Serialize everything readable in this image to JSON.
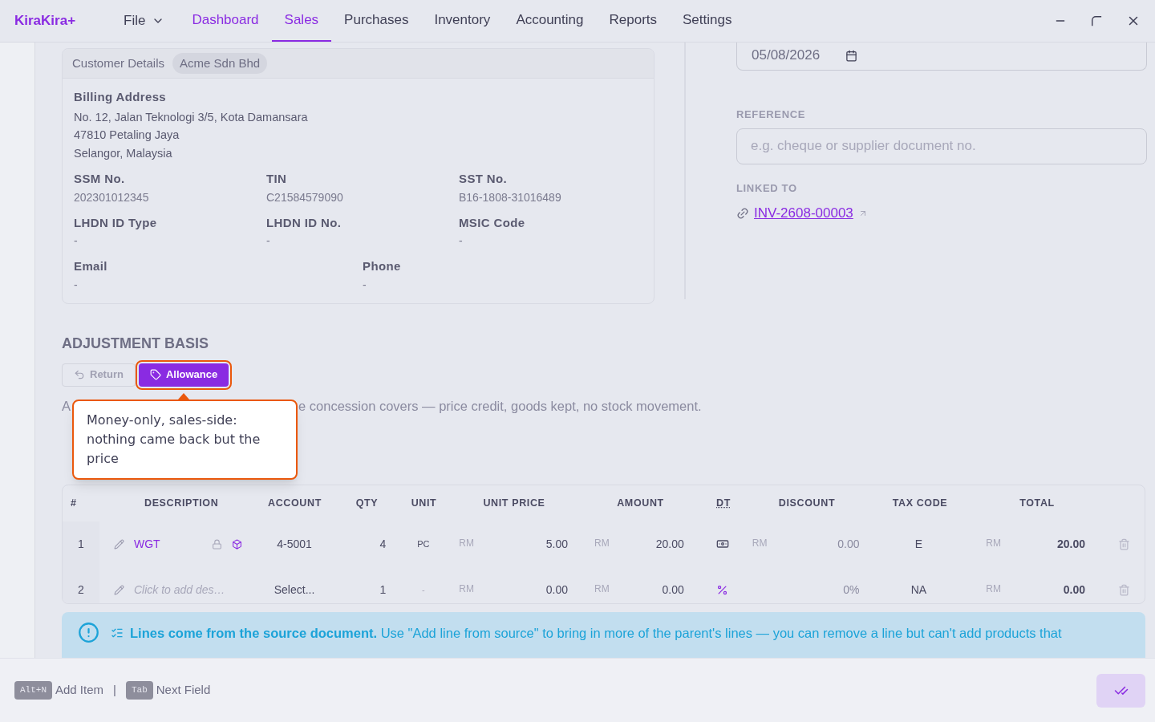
{
  "app": {
    "logo": "KiraKira+"
  },
  "menu": {
    "label": "File"
  },
  "nav": [
    {
      "label": "Dashboard",
      "selected": false,
      "highlighted": true
    },
    {
      "label": "Sales",
      "selected": true,
      "highlighted": true
    },
    {
      "label": "Purchases",
      "selected": false,
      "highlighted": false
    },
    {
      "label": "Inventory",
      "selected": false,
      "highlighted": false
    },
    {
      "label": "Accounting",
      "selected": false,
      "highlighted": false
    },
    {
      "label": "Reports",
      "selected": false,
      "highlighted": false
    },
    {
      "label": "Settings",
      "selected": false,
      "highlighted": false
    }
  ],
  "customer": {
    "title": "Customer Details",
    "name": "Acme Sdn Bhd",
    "billing_label": "Billing Address",
    "address": [
      "No. 12, Jalan Teknologi 3/5, Kota Damansara",
      "47810 Petaling Jaya",
      "Selangor, Malaysia"
    ],
    "fields": [
      {
        "label": "SSM No.",
        "value": "202301012345"
      },
      {
        "label": "TIN",
        "value": "C21584579090"
      },
      {
        "label": "SST No.",
        "value": "B16-1808-31016489"
      },
      {
        "label": "LHDN ID Type",
        "value": "-"
      },
      {
        "label": "LHDN ID No.",
        "value": "-"
      },
      {
        "label": "MSIC Code",
        "value": "-"
      }
    ],
    "contact": [
      {
        "label": "Email",
        "value": "-"
      },
      {
        "label": "Phone",
        "value": "-"
      }
    ]
  },
  "date_field": {
    "value": "05/08/2026"
  },
  "reference": {
    "label": "REFERENCE",
    "placeholder": "e.g. cheque or supplier document no."
  },
  "linked": {
    "label": "LINKED TO",
    "link": "INV-2608-00003"
  },
  "adjustment": {
    "title": "ADJUSTMENT BASIS",
    "options": [
      {
        "label": "Return",
        "kind": "return",
        "selected": false
      },
      {
        "label": "Allowance",
        "kind": "allowance",
        "selected": true
      }
    ],
    "description_start": "A",
    "description_end": "e concession covers — price credit, goods kept, no stock movement.",
    "tooltip": "Money-only, sales-side: nothing came back but the price"
  },
  "table": {
    "columns": [
      "#",
      "DESCRIPTION",
      "ACCOUNT",
      "QTY",
      "UNIT",
      "UNIT PRICE",
      "AMOUNT",
      "DT",
      "DISCOUNT",
      "TAX CODE",
      "TOTAL"
    ],
    "rows": [
      {
        "no": "1",
        "description": "WGT",
        "kind": "item",
        "account": "4-5001",
        "qty": "4",
        "unit": "PC",
        "price_currency": "RM",
        "unit_price": "5.00",
        "amount_currency": "RM",
        "amount": "20.00",
        "dt_percent": false,
        "discount_currency": "RM",
        "discount": "0.00",
        "tax_code": "E",
        "total_currency": "RM",
        "total": "20.00"
      },
      {
        "no": "2",
        "placeholder": "Click to add des…",
        "kind": "empty",
        "account": "Select...",
        "qty": "1",
        "unit": "-",
        "price_currency": "RM",
        "unit_price": "0.00",
        "amount_currency": "RM",
        "amount": "0.00",
        "dt_percent": true,
        "discount": "0%",
        "tax_code": "NA",
        "total_currency": "RM",
        "total": "0.00"
      }
    ]
  },
  "notice": {
    "bold": "Lines come from the source document.",
    "text": "Use \"Add line from source\" to bring in more of the parent's lines — you can remove a line but can't add products that"
  },
  "footer": {
    "shortcuts": [
      {
        "key": "Alt+N",
        "label": "Add Item"
      },
      {
        "key": "Tab",
        "label": "Next Field"
      }
    ],
    "separator": "|"
  }
}
